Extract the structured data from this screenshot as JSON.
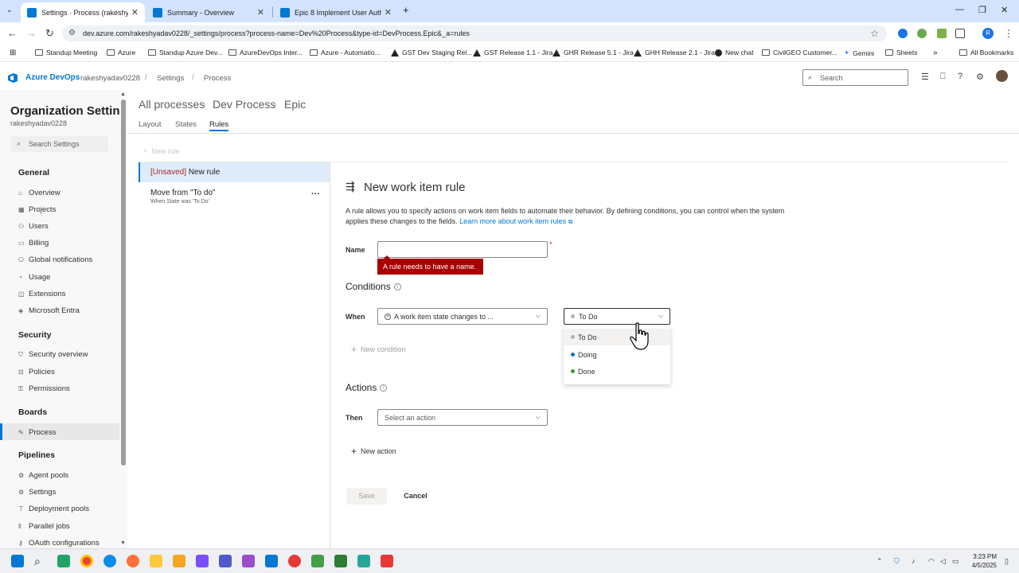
{
  "browser": {
    "tabs": [
      {
        "label": "Settings · Process (rakeshyadav",
        "active": true,
        "color": "#0078d4"
      },
      {
        "label": "Summary - Overview",
        "active": false,
        "color": "#0078d4"
      },
      {
        "label": "Epic 8 Implement User Authent",
        "active": false,
        "color": "#0078d4"
      }
    ],
    "url": "dev.azure.com/rakeshyadav0228/_settings/process?process-name=Dev%20Process&type-id=DevProcess.Epic&_a=rules",
    "bookmarks": [
      "Standup Meeting",
      "Azure",
      "Standup Azure Dev...",
      "AzureDevOps Inter...",
      "Azure - Automatio...",
      "GST Dev Staging Rel...",
      "GST Release 1.1 - Jira",
      "GHR Release 5.1 - Jira",
      "GHH Release 2.1 - Jira",
      "New chat",
      "CivilGEO Customer...",
      "Gemini",
      "Sheets",
      "All Bookmarks"
    ],
    "avatar_letter": "R"
  },
  "header": {
    "brand": "Azure DevOps",
    "org": "rakeshyadav0228",
    "crumb_settings": "Settings",
    "crumb_process": "Process",
    "search_placeholder": "Search"
  },
  "leftnav": {
    "title": "Organization Settin...",
    "subtitle": "rakeshyadav0228",
    "search_placeholder": "Search Settings",
    "sections": [
      {
        "title": "General",
        "items": [
          "Overview",
          "Projects",
          "Users",
          "Billing",
          "Global notifications",
          "Usage",
          "Extensions",
          "Microsoft Entra"
        ]
      },
      {
        "title": "Security",
        "items": [
          "Security overview",
          "Policies",
          "Permissions"
        ]
      },
      {
        "title": "Boards",
        "items": [
          "Process"
        ]
      },
      {
        "title": "Pipelines",
        "items": [
          "Agent pools",
          "Settings",
          "Deployment pools",
          "Parallel jobs",
          "OAuth configurations"
        ]
      }
    ]
  },
  "main": {
    "breadcrumb": [
      "All processes",
      "Dev Process",
      "Epic"
    ],
    "tabs": [
      "Layout",
      "States",
      "Rules"
    ],
    "new_rule_label": "New rule",
    "rules": [
      {
        "prefix": "[Unsaved]",
        "title": "New rule"
      },
      {
        "title": "Move from \"To do\"",
        "subtitle": "When State was 'To Do'"
      }
    ]
  },
  "form": {
    "title": "New work item rule",
    "description": "A rule allows you to specify actions on work item fields to automate their behavior. By defining conditions, you can control when the system applies these changes to the fields.",
    "learn_more": "Learn more about work item rules",
    "name_label": "Name",
    "name_value": "",
    "required_mark": "*",
    "name_error": "A rule needs to have a name.",
    "conditions_label": "Conditions",
    "when_label": "When",
    "condition_value": "A work item state changes to ...",
    "state_value": "To Do",
    "state_options": [
      {
        "label": "To Do",
        "color": "#b2b2b2"
      },
      {
        "label": "Doing",
        "color": "#007acc"
      },
      {
        "label": "Done",
        "color": "#339933"
      }
    ],
    "new_condition": "New condition",
    "actions_label": "Actions",
    "then_label": "Then",
    "action_placeholder": "Select an action",
    "new_action": "New action",
    "save": "Save",
    "cancel": "Cancel"
  },
  "taskbar": {
    "time": "3:23 PM",
    "date": "4/5/2025"
  }
}
